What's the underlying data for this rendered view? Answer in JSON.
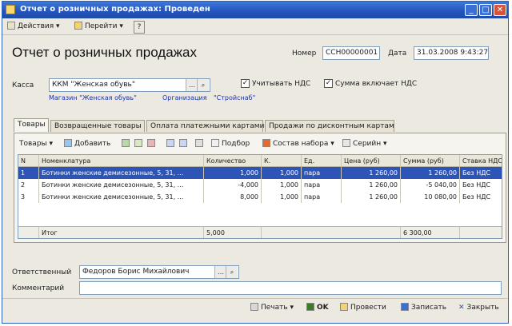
{
  "window": {
    "title": "Отчет о розничных продажах: Проведен"
  },
  "toolbar": {
    "actions": "Действия",
    "goto": "Перейти",
    "help": "?"
  },
  "header": {
    "doc_title": "Отчет о розничных продажах",
    "number_label": "Номер",
    "number_value": "ССН00000001",
    "date_label": "Дата",
    "date_value": "31.03.2008 9:43:27"
  },
  "kassa": {
    "label": "Касса",
    "value": "ККМ \"Женская обувь\"",
    "consider_vat_label": "Учитывать НДС",
    "sum_includes_vat_label": "Сумма включает НДС",
    "organization_link": "Магазин \"Женская обувь\"",
    "org_label": "Организация",
    "org_link": "\"Стройснаб\""
  },
  "tabs": [
    "Товары",
    "Возвращенные товары",
    "Оплата платежными картами",
    "Продажи по дисконтным картам"
  ],
  "grid_toolbar": {
    "goods": "Товары",
    "add": "Добавить",
    "pick": "Подбор",
    "set": "Состав набора",
    "series": "Серийн"
  },
  "table": {
    "columns": [
      "N",
      "Номенклатура",
      "Количество",
      "К.",
      "Ед.",
      "Цена (руб)",
      "Сумма (руб)",
      "Ставка НДС"
    ],
    "rows": [
      [
        "1",
        "Ботинки женские демисезонные, 5, 31, ...",
        "1,000",
        "1,000",
        "пара",
        "1 260,00",
        "1 260,00",
        "Без НДС"
      ],
      [
        "2",
        "Ботинки женские демисезонные, 5, 31, ...",
        "-4,000",
        "1,000",
        "пара",
        "1 260,00",
        "-5 040,00",
        "Без НДС"
      ],
      [
        "3",
        "Ботинки женские демисезонные, 5, 31, ...",
        "8,000",
        "1,000",
        "пара",
        "1 260,00",
        "10 080,00",
        "Без НДС"
      ]
    ],
    "footer_label": "Итог",
    "footer_qty": "5,000",
    "footer_sum": "6 300,00"
  },
  "responsible": {
    "label": "Ответственный",
    "value": "Федоров Борис Михайлович"
  },
  "comment": {
    "label": "Комментарий",
    "value": ""
  },
  "bottom": {
    "print": "Печать",
    "ok": "OK",
    "post": "Провести",
    "save": "Записать",
    "close": "Закрыть"
  }
}
